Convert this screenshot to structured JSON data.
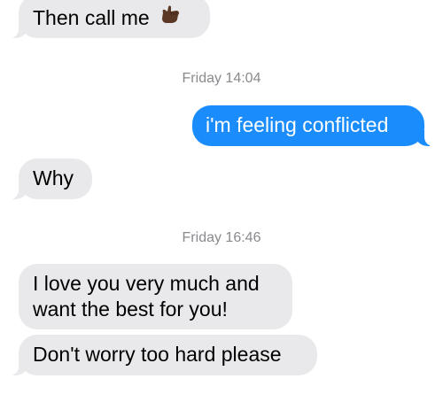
{
  "messages": [
    {
      "direction": "incoming",
      "text": "Then call me",
      "emoji": "call-me-hand-icon"
    },
    {
      "direction": "timestamp",
      "text": "Friday 14:04"
    },
    {
      "direction": "outgoing",
      "text": "i'm feeling conflicted"
    },
    {
      "direction": "incoming",
      "text": "Why"
    },
    {
      "direction": "timestamp",
      "text": "Friday 16:46"
    },
    {
      "direction": "incoming",
      "lines": [
        "I love you very much and",
        "want the best for you!"
      ]
    },
    {
      "direction": "incoming",
      "text": "Don't worry too hard please"
    }
  ],
  "colors": {
    "incoming_bubble": "#e9e9eb",
    "outgoing_bubble": "#1a8cfb",
    "timestamp_text": "#8a8a8e"
  }
}
